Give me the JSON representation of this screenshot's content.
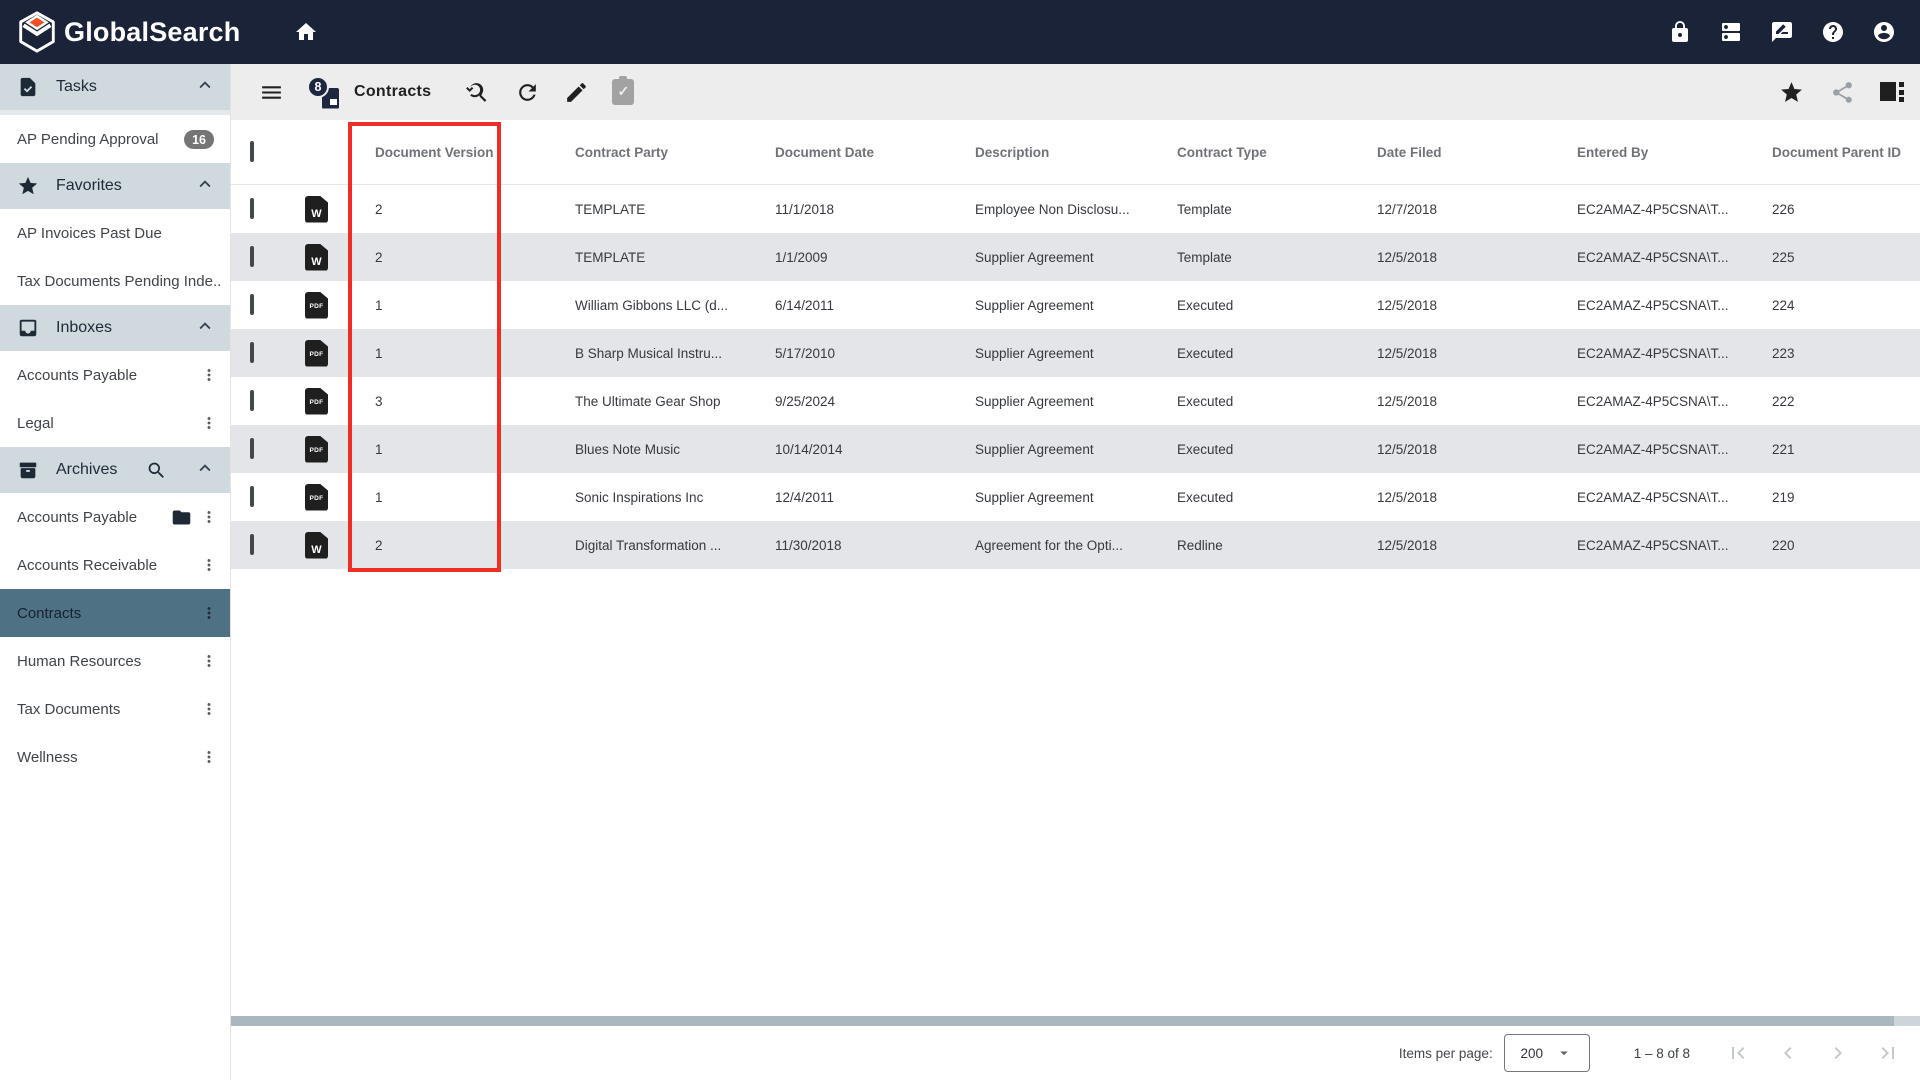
{
  "navbar": {
    "brand": "GlobalSearch"
  },
  "toolbar": {
    "results_badge": "8",
    "title": "Contracts"
  },
  "sidebar": {
    "entries": [
      {
        "type": "header",
        "icon": "tasks",
        "label": "Tasks",
        "progress": true
      },
      {
        "type": "item",
        "label": "AP Pending Approval",
        "badge": "16"
      },
      {
        "type": "header",
        "icon": "favorites",
        "label": "Favorites"
      },
      {
        "type": "item",
        "label": "AP Invoices Past Due"
      },
      {
        "type": "item",
        "label": "Tax Documents Pending Inde..."
      },
      {
        "type": "header",
        "icon": "inboxes",
        "label": "Inboxes"
      },
      {
        "type": "item",
        "label": "Accounts Payable",
        "kebab": true
      },
      {
        "type": "item",
        "label": "Legal",
        "kebab": true
      },
      {
        "type": "header",
        "icon": "archives",
        "label": "Archives",
        "search": true
      },
      {
        "type": "item",
        "label": "Accounts Payable",
        "folder": true,
        "kebab": true
      },
      {
        "type": "item",
        "label": "Accounts Receivable",
        "kebab": true
      },
      {
        "type": "item",
        "label": "Contracts",
        "kebab": true,
        "selected": true
      },
      {
        "type": "item",
        "label": "Human Resources",
        "kebab": true
      },
      {
        "type": "item",
        "label": "Tax Documents",
        "kebab": true
      },
      {
        "type": "item",
        "label": "Wellness",
        "kebab": true
      }
    ]
  },
  "table": {
    "columns": [
      "Document Version",
      "Contract Party",
      "Document Date",
      "Description",
      "Contract Type",
      "Date Filed",
      "Entered By",
      "Document Parent ID"
    ],
    "rows": [
      {
        "file_type": "word",
        "version": "2",
        "party": "TEMPLATE",
        "doc_date": "11/1/2018",
        "description": "Employee Non Disclosu...",
        "contract_type": "Template",
        "date_filed": "12/7/2018",
        "entered_by": "EC2AMAZ-4P5CSNA\\T...",
        "parent_id": "226"
      },
      {
        "file_type": "word",
        "version": "2",
        "party": "TEMPLATE",
        "doc_date": "1/1/2009",
        "description": "Supplier Agreement",
        "contract_type": "Template",
        "date_filed": "12/5/2018",
        "entered_by": "EC2AMAZ-4P5CSNA\\T...",
        "parent_id": "225"
      },
      {
        "file_type": "pdf",
        "version": "1",
        "party": "William Gibbons LLC (d...",
        "doc_date": "6/14/2011",
        "description": "Supplier Agreement",
        "contract_type": "Executed",
        "date_filed": "12/5/2018",
        "entered_by": "EC2AMAZ-4P5CSNA\\T...",
        "parent_id": "224"
      },
      {
        "file_type": "pdf",
        "version": "1",
        "party": "B Sharp Musical Instru...",
        "doc_date": "5/17/2010",
        "description": "Supplier Agreement",
        "contract_type": "Executed",
        "date_filed": "12/5/2018",
        "entered_by": "EC2AMAZ-4P5CSNA\\T...",
        "parent_id": "223"
      },
      {
        "file_type": "pdf",
        "version": "3",
        "party": "The Ultimate Gear Shop",
        "doc_date": "9/25/2024",
        "description": "Supplier Agreement",
        "contract_type": "Executed",
        "date_filed": "12/5/2018",
        "entered_by": "EC2AMAZ-4P5CSNA\\T...",
        "parent_id": "222"
      },
      {
        "file_type": "pdf",
        "version": "1",
        "party": "Blues Note Music",
        "doc_date": "10/14/2014",
        "description": "Supplier Agreement",
        "contract_type": "Executed",
        "date_filed": "12/5/2018",
        "entered_by": "EC2AMAZ-4P5CSNA\\T...",
        "parent_id": "221"
      },
      {
        "file_type": "pdf",
        "version": "1",
        "party": "Sonic Inspirations Inc",
        "doc_date": "12/4/2011",
        "description": "Supplier Agreement",
        "contract_type": "Executed",
        "date_filed": "12/5/2018",
        "entered_by": "EC2AMAZ-4P5CSNA\\T...",
        "parent_id": "219"
      },
      {
        "file_type": "word",
        "version": "2",
        "party": "Digital Transformation ...",
        "doc_date": "11/30/2018",
        "description": "Agreement for the Opti...",
        "contract_type": "Redline",
        "date_filed": "12/5/2018",
        "entered_by": "EC2AMAZ-4P5CSNA\\T...",
        "parent_id": "220"
      }
    ]
  },
  "pagination": {
    "items_per_page_label": "Items per page:",
    "items_per_page": "200",
    "range": "1 – 8 of 8"
  },
  "annotations": {
    "highlighted_column": "Document Version"
  },
  "colors": {
    "navbar_bg": "#1a2337",
    "accent_orange": "#f05023",
    "section_header_bg": "#cfd9de",
    "selected_item_bg": "#4e7183",
    "row_alt_bg": "#e3e5e8",
    "highlight_red": "#ee2e24",
    "badge_gray": "#757575",
    "scrollbar_thumb": "#a9b7be"
  }
}
